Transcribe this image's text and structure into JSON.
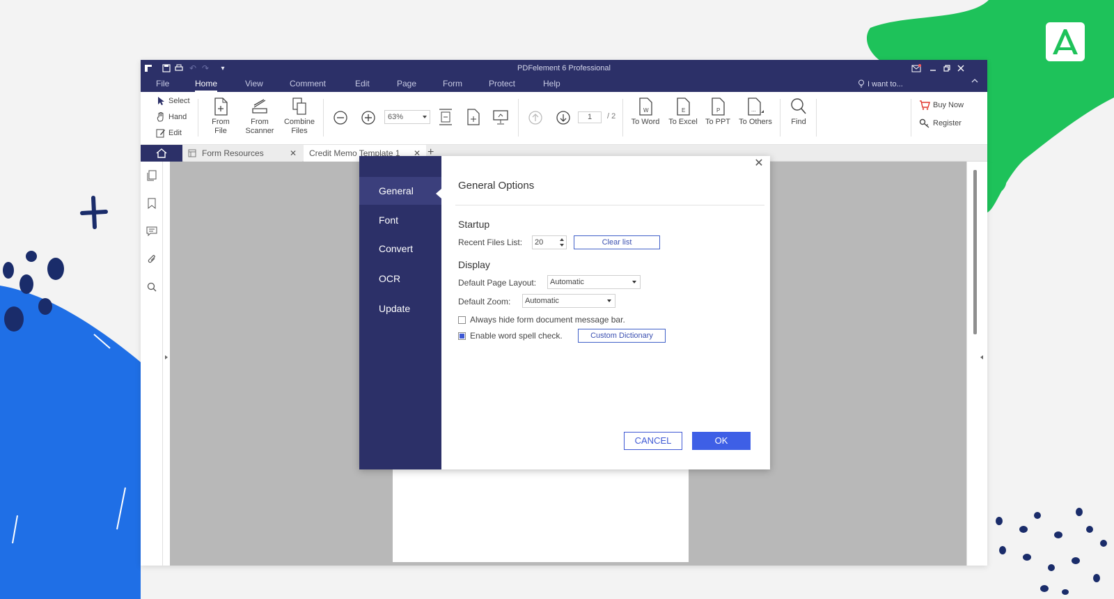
{
  "app": {
    "title": "PDFelement 6 Professional"
  },
  "menubar": {
    "items": [
      "File",
      "Home",
      "View",
      "Comment",
      "Edit",
      "Page",
      "Form",
      "Protect",
      "Help"
    ],
    "active": "Home",
    "i_want_to": "I want to..."
  },
  "ribbon": {
    "select": "Select",
    "hand": "Hand",
    "edit": "Edit",
    "from_file": "From File",
    "from_scanner_1": "From",
    "from_scanner_2": "Scanner",
    "combine_1": "Combine",
    "combine_2": "Files",
    "zoom": "63%",
    "page_current": "1",
    "page_total": "/ 2",
    "to_word": "To Word",
    "to_excel": "To Excel",
    "to_ppt": "To PPT",
    "to_others": "To Others",
    "find": "Find",
    "buy_now": "Buy Now",
    "register": "Register"
  },
  "tabs": {
    "first": "Form Resources",
    "second": "Credit Memo Template 1"
  },
  "dialog": {
    "nav": [
      "General",
      "Font",
      "Convert",
      "OCR",
      "Update"
    ],
    "active": "General",
    "title": "General Options",
    "startup": {
      "heading": "Startup",
      "recent_label": "Recent Files List:",
      "recent_value": "20",
      "clear": "Clear list"
    },
    "display": {
      "heading": "Display",
      "layout_label": "Default Page Layout:",
      "layout_value": "Automatic",
      "zoom_label": "Default Zoom:",
      "zoom_value": "Automatic",
      "hide_msg": "Always hide form document message bar.",
      "hide_msg_checked": false,
      "spell": "Enable word spell check.",
      "spell_checked": true,
      "custom_dict": "Custom Dictionary"
    },
    "cancel": "CANCEL",
    "ok": "OK"
  },
  "colors": {
    "brand_navy": "#2c3068",
    "accent_blue": "#3e5fe6",
    "deco_green": "#1ec25a",
    "deco_blue": "#1f6fe6"
  }
}
